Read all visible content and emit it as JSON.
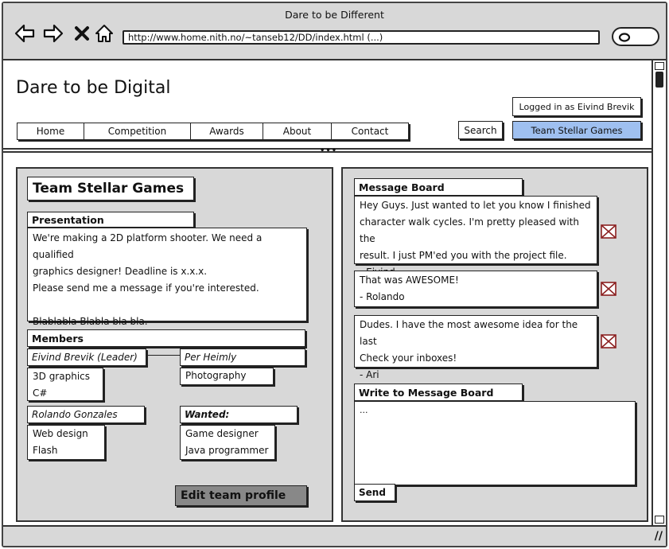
{
  "window": {
    "title": "Dare to be Different",
    "url": "http://www.home.nith.no/~tanseb12/DD/index.html (...)"
  },
  "nav_icons": [
    "back-arrow-icon",
    "forward-arrow-icon",
    "close-x-icon",
    "home-icon"
  ],
  "site": {
    "title": "Dare to be Digital",
    "login_status": "Logged in as Eivind Brevik",
    "menu": [
      "Home",
      "Competition",
      "Awards",
      "About",
      "Contact"
    ],
    "search_label": "Search",
    "team_button": "Team Stellar Games",
    "team_button_color": "#9fc0f0"
  },
  "team": {
    "name": "Team Stellar Games",
    "presentation": {
      "header": "Presentation",
      "lines": [
        "We're making a 2D platform shooter. We need a qualified",
        "graphics designer! Deadline is x.x.x.",
        "Please send me a message if you're interested.",
        "",
        "Blablabla Blabla bla bla."
      ]
    },
    "members": {
      "header": "Members",
      "list": [
        {
          "name": "Eivind Brevik (Leader)",
          "skills": [
            "3D graphics",
            "C#"
          ]
        },
        {
          "name": "Per Heimly",
          "skills": [
            "Photography"
          ]
        },
        {
          "name": "Rolando Gonzales",
          "skills": [
            "Web design",
            "Flash"
          ]
        },
        {
          "name": "Wanted:",
          "skills": [
            "Game designer",
            "Java programmer"
          ]
        }
      ]
    },
    "edit_button": "Edit team profile"
  },
  "message_board": {
    "header": "Message Board",
    "messages": [
      {
        "lines": [
          "Hey Guys. Just wanted to let you know I finished",
          "character walk cycles. I'm pretty pleased with the",
          "result. I just PM'ed you with the project file.",
          "- Eivind"
        ]
      },
      {
        "lines": [
          "That was AWESOME!",
          "- Rolando"
        ]
      },
      {
        "lines": [
          "Dudes. I have the most awesome idea for the last",
          "Check your inboxes!",
          "- Ari"
        ]
      }
    ],
    "write_header": "Write to Message Board",
    "write_placeholder": "...",
    "send_label": "Send"
  }
}
